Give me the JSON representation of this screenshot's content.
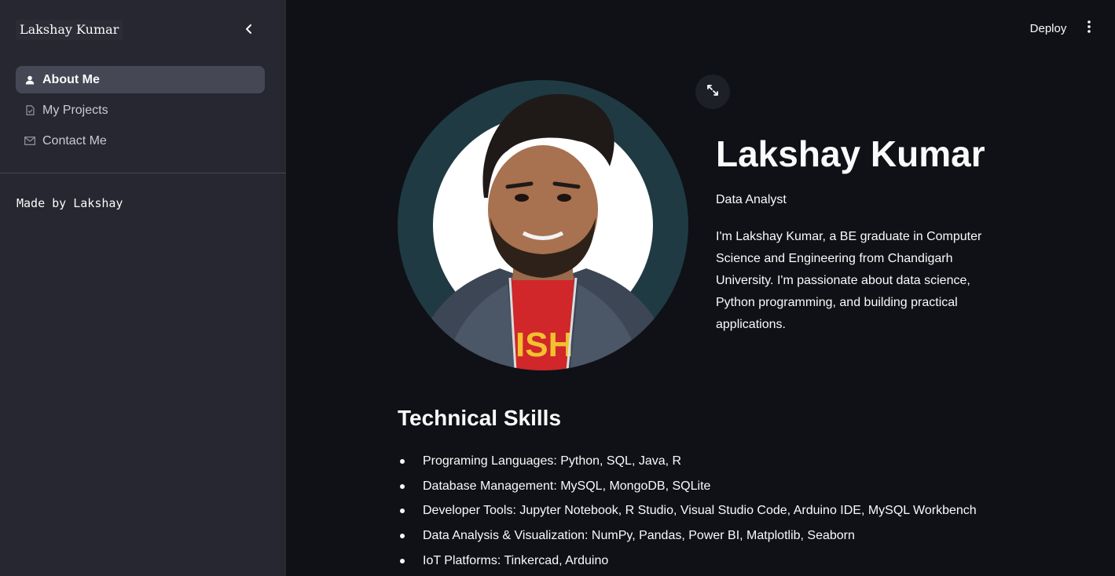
{
  "sidebar": {
    "brand": "Lakshay Kumar",
    "collapse_icon": "chevron-left-icon",
    "items": [
      {
        "label": "About Me",
        "icon": "user-icon",
        "active": true
      },
      {
        "label": "My Projects",
        "icon": "file-icon",
        "active": false
      },
      {
        "label": "Contact Me",
        "icon": "mail-icon",
        "active": false
      }
    ],
    "footer": "Made by Lakshay"
  },
  "header": {
    "deploy_label": "Deploy",
    "menu_icon": "kebab-menu-icon"
  },
  "profile": {
    "expand_icon": "expand-icon",
    "name": "Lakshay Kumar",
    "role": "Data Analyst",
    "bio": "I'm Lakshay Kumar, a BE graduate in Computer Science and Engineering from Chandigarh University. I'm passionate about data science, Python programming, and building practical applications."
  },
  "skills": {
    "title": "Technical Skills",
    "items": [
      "Programing Languages: Python, SQL, Java, R",
      "Database Management: MySQL, MongoDB, SQLite",
      "Developer Tools: Jupyter Notebook, R Studio, Visual Studio Code, Arduino IDE, MySQL Workbench",
      "Data Analysis & Visualization: NumPy, Pandas, Power BI, Matplotlib, Seaborn",
      "IoT Platforms: Tinkercad, Arduino"
    ]
  },
  "colors": {
    "background": "#0f1117",
    "sidebar": "#262730",
    "active_item": "#464755",
    "avatar_ring": "#1f3a42"
  }
}
